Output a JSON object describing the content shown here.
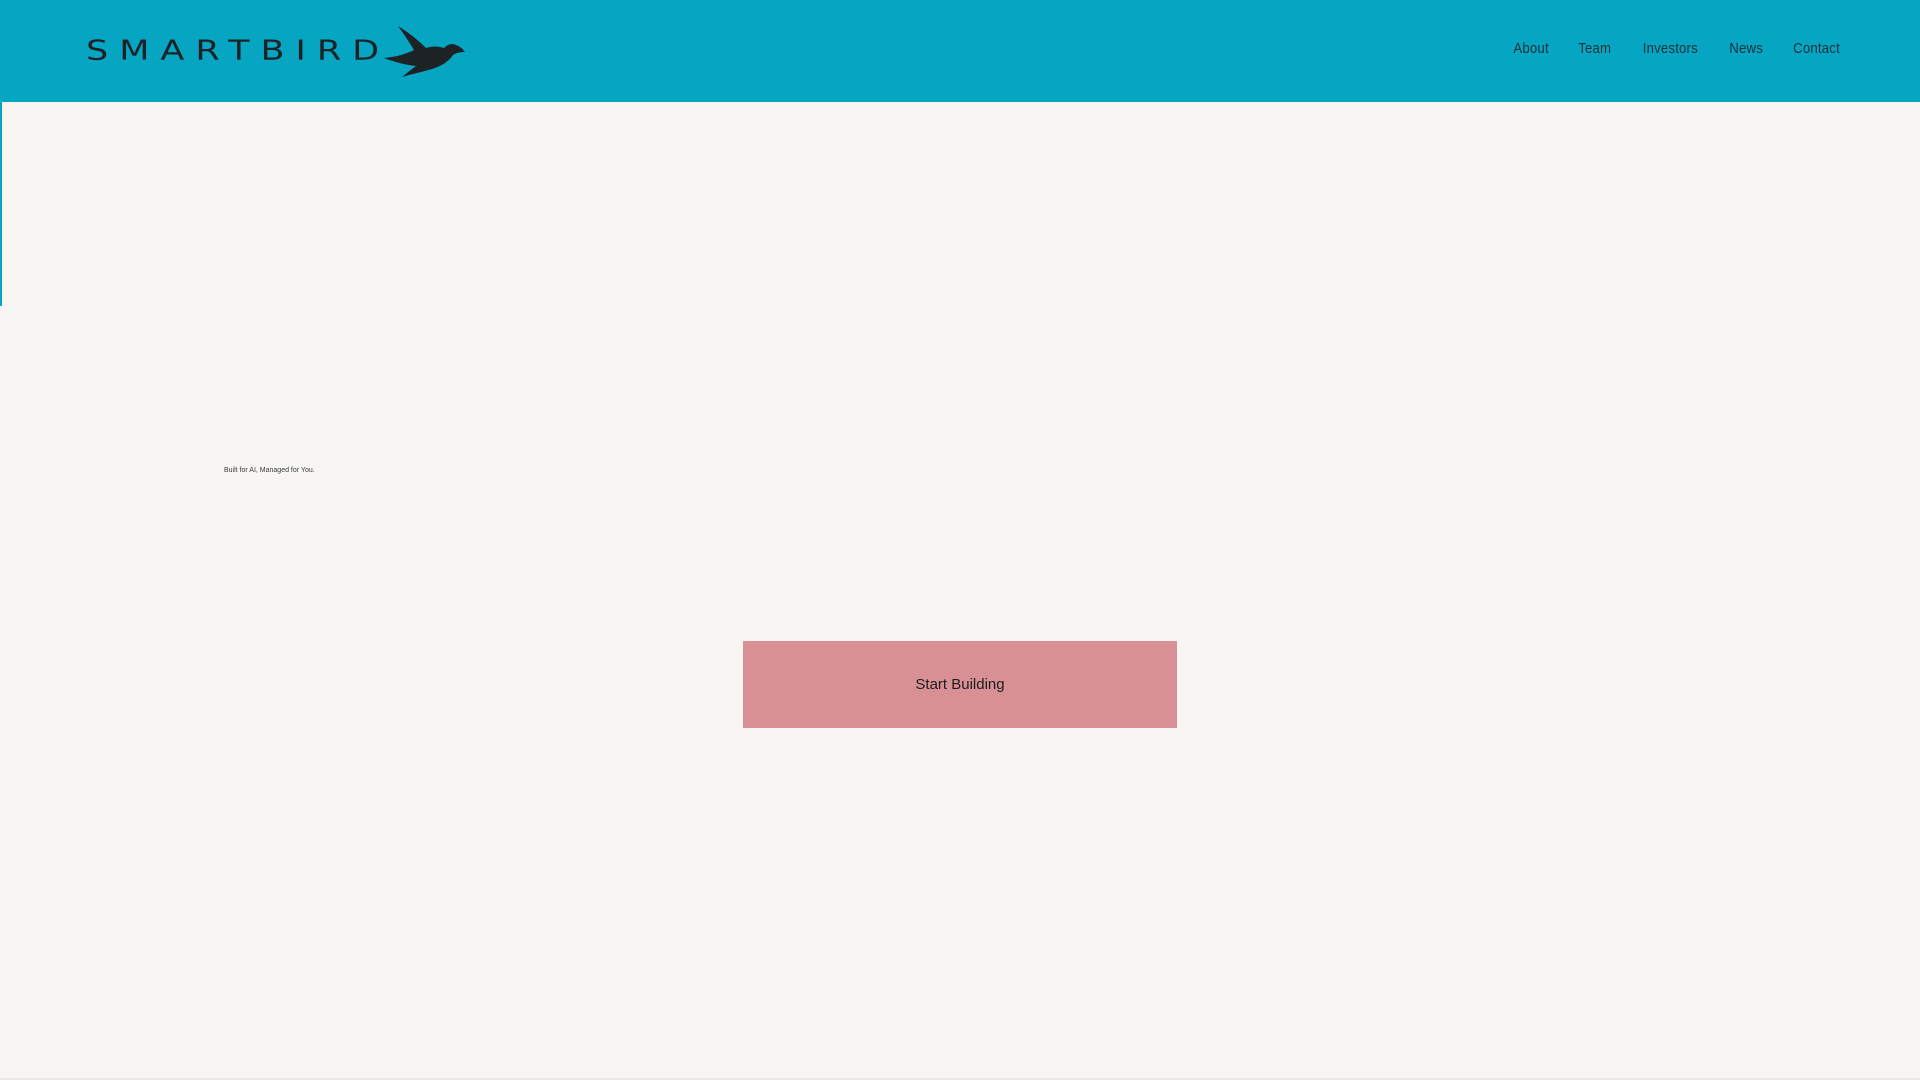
{
  "brand": {
    "name": "SMARTBIRD",
    "logo_icon": "bird-icon",
    "colors": {
      "header_bg": "#06a6c2",
      "page_bg": "#f7f6f2",
      "cta_bg": "#d99095",
      "text": "#1c2226"
    }
  },
  "nav": {
    "items": [
      {
        "label": "About"
      },
      {
        "label": "Team"
      },
      {
        "label": "Investors"
      },
      {
        "label": "News"
      },
      {
        "label": "Contact"
      }
    ]
  },
  "hero": {
    "tagline": "Built for AI, Managed for You.",
    "cta_label": "Start Building"
  }
}
